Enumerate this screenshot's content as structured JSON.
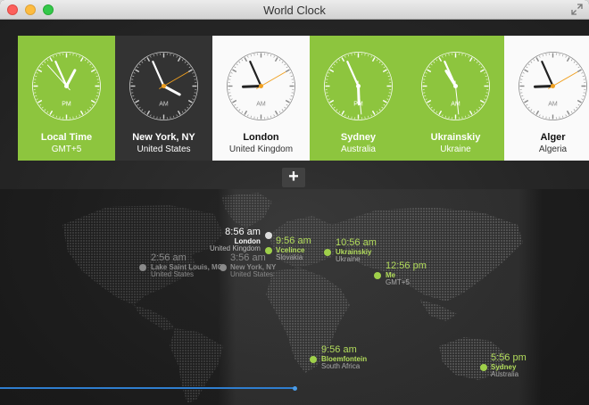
{
  "window": {
    "title": "World Clock"
  },
  "clocks": [
    {
      "city": "Local Time",
      "country": "GMT+5",
      "ampm": "PM",
      "theme": "green",
      "hour": 12,
      "minute": 56,
      "second": 53
    },
    {
      "city": "New York, NY",
      "country": "United States",
      "ampm": "AM",
      "theme": "dark",
      "hour": 3,
      "minute": 56,
      "second": 10
    },
    {
      "city": "London",
      "country": "United Kingdom",
      "ampm": "AM",
      "theme": "white",
      "hour": 8,
      "minute": 56,
      "second": 10
    },
    {
      "city": "Sydney",
      "country": "Australia",
      "ampm": "PM",
      "theme": "green",
      "hour": 5,
      "minute": 56,
      "second": 29
    },
    {
      "city": "Ukrainskiy",
      "country": "Ukraine",
      "ampm": "AM",
      "theme": "green",
      "hour": 10,
      "minute": 56,
      "second": 29
    },
    {
      "city": "Alger",
      "country": "Algeria",
      "ampm": "AM",
      "theme": "white",
      "hour": 8,
      "minute": 56,
      "second": 10
    }
  ],
  "add_button": {
    "label": "+"
  },
  "markers": [
    {
      "time": "8:56 am",
      "name": "London",
      "country": "United Kingdom",
      "style": "white",
      "align": "right"
    },
    {
      "time": "9:56 am",
      "name": "Vcelince",
      "country": "Slovakia",
      "style": "green",
      "align": "left"
    },
    {
      "time": "10:56 am",
      "name": "Ukrainskiy",
      "country": "Ukraine",
      "style": "green",
      "align": "left"
    },
    {
      "time": "2:56 am",
      "name": "Lake Saint Louis, MO",
      "country": "United States",
      "style": "gray",
      "align": "left"
    },
    {
      "time": "3:56 am",
      "name": "New York, NY",
      "country": "United States",
      "style": "gray",
      "align": "left"
    },
    {
      "time": "12:56 pm",
      "name": "Me",
      "country": "GMT+5",
      "style": "green",
      "align": "left"
    },
    {
      "time": "9:56 am",
      "name": "Bloemfontein",
      "country": "South Africa",
      "style": "green",
      "align": "left"
    },
    {
      "time": "5:56 pm",
      "name": "Sydney",
      "country": "Australia",
      "style": "green",
      "align": "left"
    }
  ],
  "timeline": {
    "progress": 0.5
  },
  "colors": {
    "accent_green": "#8dc53e",
    "timeline_blue": "#2f7ecf"
  }
}
